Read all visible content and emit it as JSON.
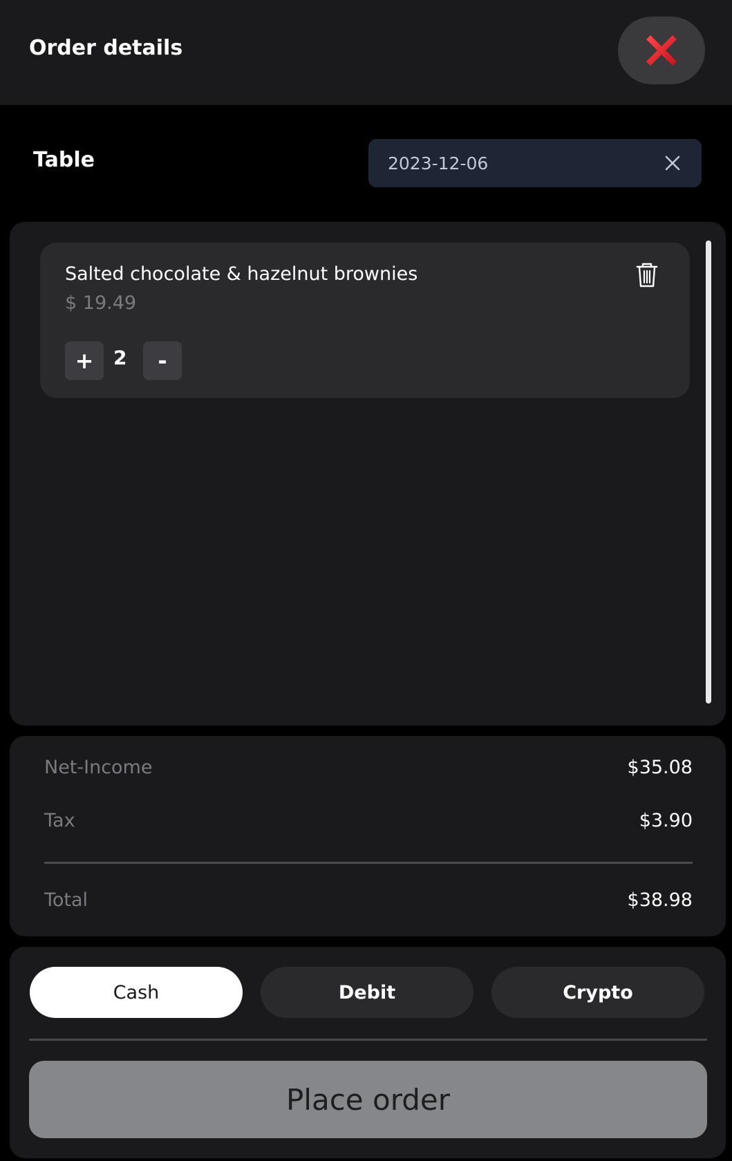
{
  "header": {
    "title": "Order details",
    "close_icon": "red-x-icon"
  },
  "table": {
    "label": "Table",
    "date_value": "2023-12-06",
    "clear_icon": "close-icon"
  },
  "items": [
    {
      "name": "Salted chocolate & hazelnut brownies",
      "price": "$ 19.49",
      "quantity": "2",
      "plus_label": "+",
      "minus_label": "-",
      "delete_icon": "trash-icon"
    }
  ],
  "summary": {
    "net_income_label": "Net-Income",
    "net_income_value": "$35.08",
    "tax_label": "Tax",
    "tax_value": "$3.90",
    "total_label": "Total",
    "total_value": "$38.98"
  },
  "payment": {
    "options": [
      "Cash",
      "Debit",
      "Crypto"
    ],
    "selected": "Cash",
    "place_order_label": "Place order"
  },
  "colors": {
    "background": "#000000",
    "panel": "#1a1a1c",
    "card": "#2a2a2d",
    "date_field": "#1e2636",
    "place_order_disabled": "#86878a",
    "close_red": "#e0202a"
  }
}
